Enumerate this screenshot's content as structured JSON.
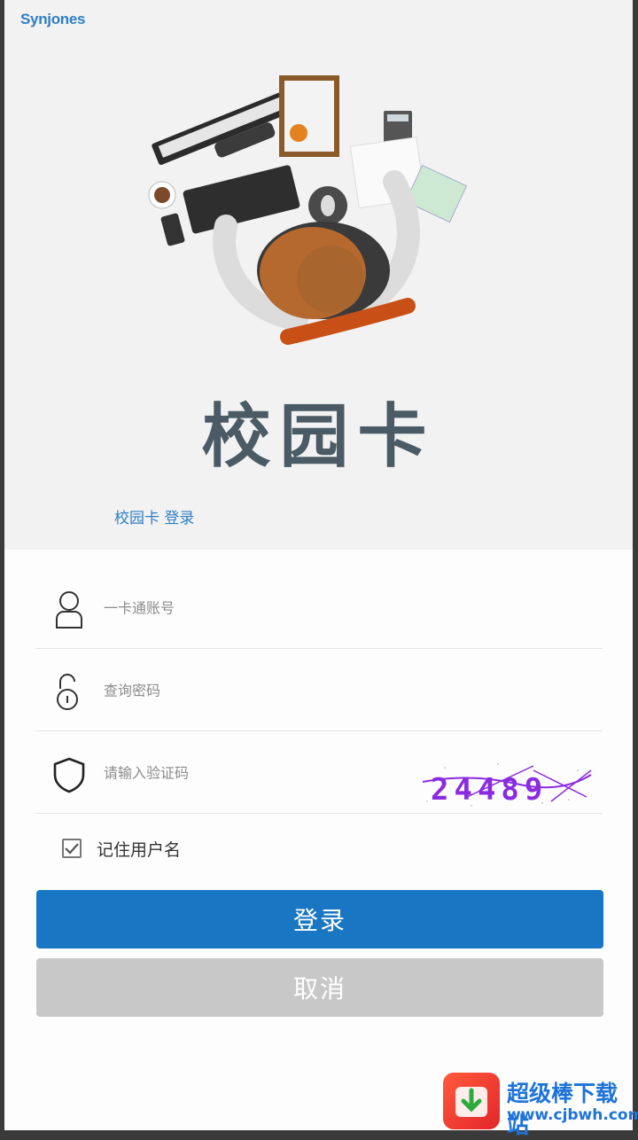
{
  "brand": {
    "logo_text": "Synjones"
  },
  "hero": {
    "app_title": "校园卡",
    "subtitle": "校园卡 登录"
  },
  "form": {
    "account": {
      "placeholder": "一卡通账号",
      "value": ""
    },
    "password": {
      "placeholder": "查询密码",
      "value": ""
    },
    "captcha": {
      "placeholder": "请输入验证码",
      "value": "",
      "image_text": "24489"
    },
    "remember": {
      "label": "记住用户名",
      "checked": true
    }
  },
  "buttons": {
    "login": "登录",
    "cancel": "取消"
  },
  "watermark": {
    "title": "超级棒下载站",
    "url": "www.cjbwh.com"
  },
  "colors": {
    "primary": "#1976c2",
    "disabled": "#c8c8c8",
    "captcha": "#8a2be2"
  }
}
